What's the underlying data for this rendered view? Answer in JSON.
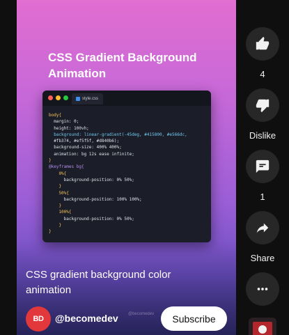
{
  "short": {
    "thumbnail_title": "CSS Gradient Background Animation",
    "code_tab": "style.css",
    "code_lines": [
      "body{",
      "  margin: 0;",
      "  height: 100vh;",
      "  background: linear-gradient(-45deg, #415800, #e566dc,",
      "  #fb374, #ef5f5f, #d840b6);",
      "  background-size: 400% 400%;",
      "  animation: bg 12s ease infinite;",
      "}",
      "@keyframes bg{",
      "    0%{",
      "      background-position: 0% 50%;",
      "    }",
      "    50%{",
      "      background-position: 100% 100%;",
      "    }",
      "    100%{",
      "      background-position: 0% 50%;",
      "    }",
      "}"
    ],
    "watermark": "@becomedev",
    "video_title": "CSS gradient background color animation",
    "channel": {
      "avatar_text": "BD",
      "name": "@becomedev"
    },
    "subscribe_label": "Subscribe"
  },
  "actions": {
    "like": {
      "icon": "thumbs-up-icon",
      "label": "4"
    },
    "dislike": {
      "icon": "thumbs-down-icon",
      "label": "Dislike"
    },
    "comments": {
      "icon": "comment-icon",
      "label": "1"
    },
    "share": {
      "icon": "share-icon",
      "label": "Share"
    },
    "more": {
      "icon": "more-horizontal-icon",
      "label": ""
    }
  },
  "colors": {
    "background": "#0f0f0f",
    "action_button": "#272727",
    "avatar": "#e2383c",
    "gradient_top": "#e46ed0",
    "gradient_bottom": "#3d3a8c"
  }
}
